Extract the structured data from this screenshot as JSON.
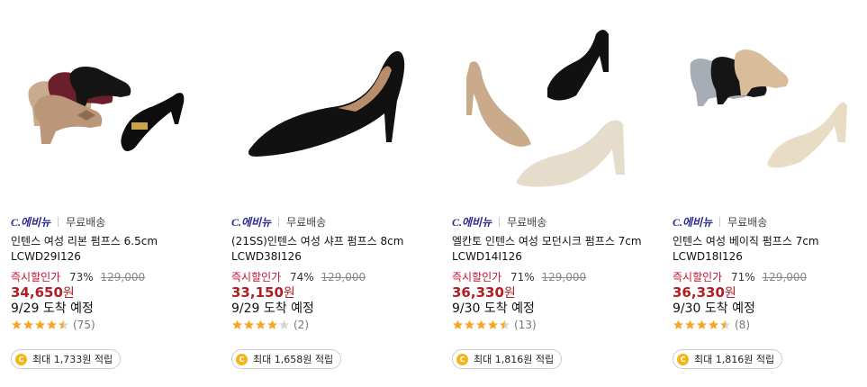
{
  "products": [
    {
      "brand_logo": "C.에비뉴",
      "shipping": "무료배송",
      "title": "인텐스 여성 리본 펌프스 6.5cm LCWD29I126",
      "discount_label": "즉시할인가",
      "discount_pct": "73%",
      "original_price": "129,000",
      "price": "34,650",
      "currency": "원",
      "arrival": "9/29 도착 예정",
      "rating": 4.5,
      "review_count": "(75)",
      "points_text": "최대 1,733원 적립",
      "image_icon": "pumps-ribbon-trio-image"
    },
    {
      "brand_logo": "C.에비뉴",
      "shipping": "무료배송",
      "title": "(21SS)인텐스 여성 샤프 펌프스 8cm LCWD38I126",
      "discount_label": "즉시할인가",
      "discount_pct": "74%",
      "original_price": "129,000",
      "price": "33,150",
      "currency": "원",
      "arrival": "9/29 도착 예정",
      "rating": 4,
      "review_count": "(2)",
      "points_text": "최대 1,658원 적립",
      "image_icon": "black-stiletto-pump-image"
    },
    {
      "brand_logo": "C.에비뉴",
      "shipping": "무료배송",
      "title": "엘칸토 인텐스 여성 모던시크 펌프스 7cm LCWD14I126",
      "discount_label": "즉시할인가",
      "discount_pct": "71%",
      "original_price": "129,000",
      "price": "36,330",
      "currency": "원",
      "arrival": "9/30 도착 예정",
      "rating": 4.5,
      "review_count": "(13)",
      "points_text": "최대 1,816원 적립",
      "image_icon": "block-heel-pumps-image"
    },
    {
      "brand_logo": "C.에비뉴",
      "shipping": "무료배송",
      "title": "인텐스 여성 베이직 펌프스 7cm LCWD18I126",
      "discount_label": "즉시할인가",
      "discount_pct": "71%",
      "original_price": "129,000",
      "price": "36,330",
      "currency": "원",
      "arrival": "9/30 도착 예정",
      "rating": 4.5,
      "review_count": "(8)",
      "points_text": "최대 1,816원 적립",
      "image_icon": "platform-pumps-image"
    }
  ],
  "colors": {
    "sale_red": "#c8102e",
    "price_red": "#b21e23",
    "star": "#f5a623",
    "brand_navy": "#2a2a8c"
  }
}
